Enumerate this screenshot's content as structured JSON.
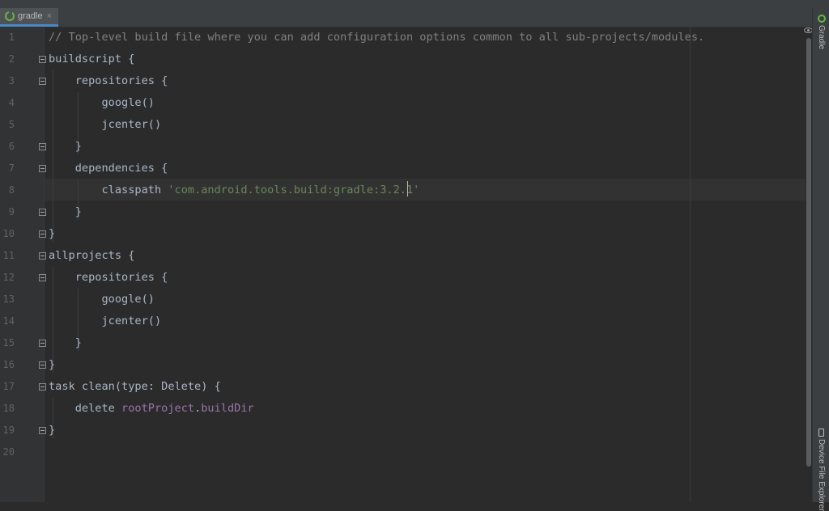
{
  "tab": {
    "label": "gradle",
    "close": "×",
    "icon": "gradle-icon"
  },
  "colors": {
    "background": "#2b2b2b",
    "gutter": "#313335",
    "comment": "#808080",
    "string": "#6a8759",
    "property": "#9876aa",
    "code": "#a9b7c6",
    "line_number": "#606366"
  },
  "editor": {
    "current_line": 8,
    "lines": [
      {
        "number": "1",
        "segments": [
          {
            "text": "// Top-level build file where you can add configuration options common to all sub-projects/modules.",
            "kind": "comment"
          }
        ]
      },
      {
        "number": "2",
        "segments": [
          {
            "text": "buildscript {",
            "kind": "plain"
          }
        ]
      },
      {
        "number": "3",
        "segments": [
          {
            "text": "    repositories {",
            "kind": "plain"
          }
        ]
      },
      {
        "number": "4",
        "segments": [
          {
            "text": "        google()",
            "kind": "plain"
          }
        ]
      },
      {
        "number": "5",
        "segments": [
          {
            "text": "        jcenter()",
            "kind": "plain"
          }
        ]
      },
      {
        "number": "6",
        "segments": [
          {
            "text": "    }",
            "kind": "plain"
          }
        ]
      },
      {
        "number": "7",
        "segments": [
          {
            "text": "    dependencies {",
            "kind": "plain"
          }
        ]
      },
      {
        "number": "8",
        "segments": [
          {
            "text": "        classpath ",
            "kind": "plain"
          },
          {
            "text": "'com.android.tools.build:gradle:3.2.1'",
            "kind": "string"
          }
        ]
      },
      {
        "number": "9",
        "segments": [
          {
            "text": "    }",
            "kind": "plain"
          }
        ]
      },
      {
        "number": "10",
        "segments": [
          {
            "text": "}",
            "kind": "plain"
          }
        ]
      },
      {
        "number": "11",
        "segments": [
          {
            "text": "allprojects {",
            "kind": "plain"
          }
        ]
      },
      {
        "number": "12",
        "segments": [
          {
            "text": "    repositories {",
            "kind": "plain"
          }
        ]
      },
      {
        "number": "13",
        "segments": [
          {
            "text": "        google()",
            "kind": "plain"
          }
        ]
      },
      {
        "number": "14",
        "segments": [
          {
            "text": "        jcenter()",
            "kind": "plain"
          }
        ]
      },
      {
        "number": "15",
        "segments": [
          {
            "text": "    }",
            "kind": "plain"
          }
        ]
      },
      {
        "number": "16",
        "segments": [
          {
            "text": "}",
            "kind": "plain"
          }
        ]
      },
      {
        "number": "17",
        "segments": [
          {
            "text": "task clean(type: Delete) {",
            "kind": "plain"
          }
        ]
      },
      {
        "number": "18",
        "segments": [
          {
            "text": "    delete ",
            "kind": "plain"
          },
          {
            "text": "rootProject",
            "kind": "property"
          },
          {
            "text": ".",
            "kind": "plain"
          },
          {
            "text": "buildDir",
            "kind": "property"
          }
        ]
      },
      {
        "number": "19",
        "segments": [
          {
            "text": "}",
            "kind": "plain"
          }
        ]
      },
      {
        "number": "20",
        "segments": []
      }
    ]
  },
  "tool_windows": {
    "gradle": {
      "label": "Gradle",
      "icon": "gradle-icon"
    },
    "device_file_explorer": {
      "label": "Device File Explorer",
      "icon": "device-icon"
    }
  }
}
